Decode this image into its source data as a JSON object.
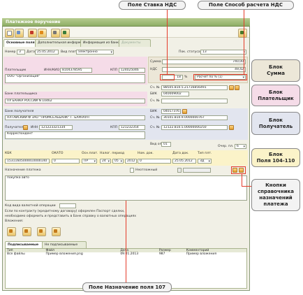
{
  "window": {
    "title": "Платежное поручение"
  },
  "tabs": [
    "Основные поля",
    "Дополнительная информация",
    "Информация из банка",
    "Документы"
  ],
  "header": {
    "number_label": "Номер",
    "number": "3",
    "date_label": "Дата",
    "date": "25.05.2012",
    "pay_type_label": "Вид платежа",
    "pay_type": "электронно",
    "status_label": "Пок. статуса",
    "status": "13"
  },
  "payer": {
    "label": "Плательщик",
    "inn_label": "ИНН/КИО",
    "inn": "8104378595",
    "kpp_label": "КПП",
    "kpp": "124025046",
    "name": "ООО \"Организация\"",
    "account_label": "Сч. №",
    "account": "88505.810.5.21716856491",
    "bank_label": "Банк плательщика",
    "bank": "ПУ БАНКА РОССИИ N 10462",
    "bik_label": "БИК",
    "bik": "040009002",
    "corr_label": "Сч. №",
    "corr": ""
  },
  "sum": {
    "sum_label": "Сумма",
    "sum": "740,00",
    "vat_label": "НДС",
    "vat": "49,42",
    "rate": "18",
    "rate_unit": "%",
    "calc": "Расчет по % (1)"
  },
  "payee": {
    "bank_label": "Банк получателя",
    "bik_label": "БИК",
    "bik": "040173767",
    "bank": "АЛТАЙСКИЙ Ф ЗАО \"ПРОМСЕЛЬБАНК\" Г. БАРНАУЛ",
    "corr_label": "Сч. №",
    "corr": "30101.810.9.0000000767",
    "label": "Получатель",
    "inn_label": "ИНН",
    "inn": "121223321334",
    "kpp_label": "КПП",
    "kpp": "121232354",
    "account_label": "Сч. №",
    "account": "12122.810.5.00000000250",
    "name": "Корреспондент"
  },
  "order": {
    "vid_label": "Вид оп.",
    "vid": "01",
    "queue_label": "Очер. пл.",
    "queue": "6"
  },
  "fields104": {
    "headers": [
      "КБК",
      "ОКАТО",
      "Осн.плат.",
      "Налог. период",
      "Ном. док.",
      "Дата док.",
      "Тип плт."
    ],
    "kbk": "15311605000010000140",
    "okato": "0",
    "osn": "ПР",
    "p1": "24",
    "p2": "05",
    "p3": "2012",
    "num": "0",
    "date": "25.05.2012",
    "type": "ЗД"
  },
  "purpose": {
    "label": "Назначение платежа",
    "nontax_label": "Неотложный",
    "text": "покупка авто"
  },
  "currency": {
    "label": "Код вида валютной операции",
    "note1": "Если по контракту (кредитному договору) оформлен Паспорт сделки,",
    "note2": "необходимо оформить и представить в Банк справку о валютных операциях",
    "attachments_label": "Вложения:"
  },
  "signatures": {
    "tabs": [
      "Подписываемые",
      "Не подписываемые"
    ],
    "columns": [
      "Тип",
      "Файл",
      "Дата",
      "Размер",
      "Комментарий"
    ],
    "rows": [
      [
        "Все файлы",
        "Пример вложения.png",
        "09.01.2013",
        "987",
        "Пример вложения"
      ]
    ]
  },
  "callouts": {
    "vat_rate": "Поле Ставка НДС",
    "vat_calc": "Поле Способ расчета НДС",
    "sum_block": "Блок\nСумма",
    "payer_block": "Блок\nПлательщик",
    "payee_block": "Блок\nПолучатель",
    "f104_block": "Блок\nПоля 104-110",
    "buttons_block": "Кнопки\nсправочника\nназначений\nплатежа",
    "purpose107": "Поле Назначение поля 107"
  },
  "colors": {
    "payer_bg": "#f5dce8",
    "sum_bg": "#ece7d8",
    "payee_bg": "#e2e5ef",
    "f104_bg": "#fbf3c9",
    "accent": "#e53b2a"
  }
}
